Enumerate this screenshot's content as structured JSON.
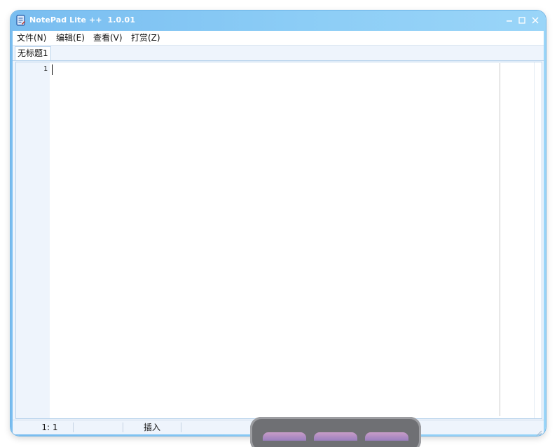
{
  "window": {
    "title": "NotePad Lite ++  1.0.01",
    "icon": "notepad-icon",
    "controls": {
      "minimize": "minimize-icon",
      "maximize": "maximize-icon",
      "close": "close-icon"
    }
  },
  "menu": {
    "items": [
      {
        "label": "文件(N)"
      },
      {
        "label": "编辑(E)"
      },
      {
        "label": "查看(V)"
      },
      {
        "label": "打赏(Z)"
      }
    ]
  },
  "tabs": [
    {
      "label": "无标题1",
      "active": true
    }
  ],
  "editor": {
    "line_numbers": [
      "1"
    ],
    "content": ""
  },
  "status": {
    "position": "1:  1",
    "mode": "插入"
  },
  "colors": {
    "titlebar_start": "#79bdf0",
    "titlebar_end": "#9ad5f8",
    "gutter": "#eef4fc",
    "dock": "#6f7074",
    "dock_item": "#b08ec6"
  }
}
